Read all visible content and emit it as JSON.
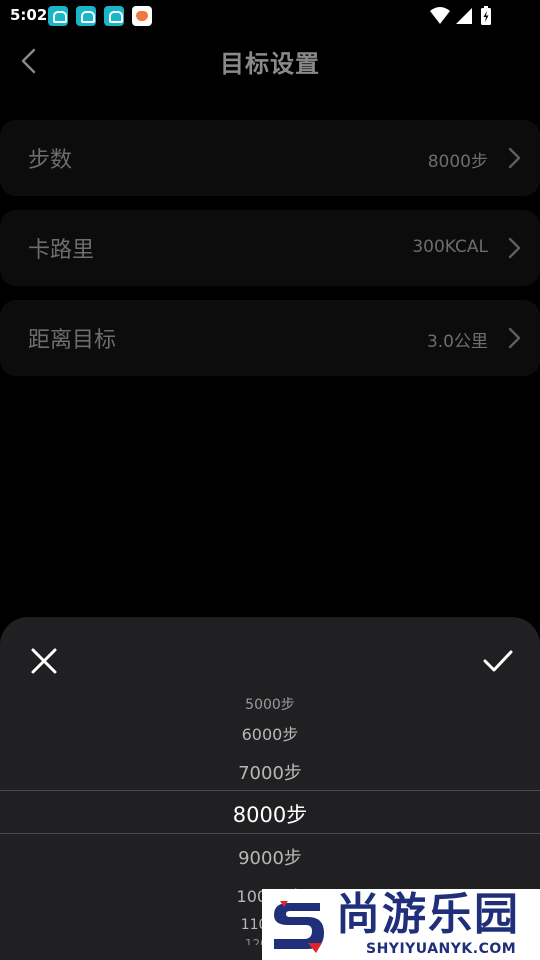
{
  "status_bar": {
    "time": "5:02",
    "icons": [
      "app-notification-icon",
      "app-notification-icon",
      "app-notification-icon",
      "health-app-icon",
      "wifi-icon",
      "signal-icon",
      "battery-charging-icon"
    ]
  },
  "header": {
    "back_icon": "chevron-left-icon",
    "title": "目标设置"
  },
  "settings": {
    "rows": [
      {
        "label": "步数",
        "value": "8000步"
      },
      {
        "label": "卡路里",
        "value": "300KCAL"
      },
      {
        "label": "距离目标",
        "value": "3.0公里"
      }
    ]
  },
  "sheet": {
    "close_icon": "close-icon",
    "confirm_icon": "check-icon",
    "picker": {
      "items": [
        "5000步",
        "6000步",
        "7000步",
        "8000步",
        "9000步",
        "10000步",
        "11000步",
        "12000步"
      ],
      "selected": "8000步"
    }
  },
  "watermark": {
    "text": "尚游乐园",
    "url": "SHYIYUANYK.COM"
  },
  "colors": {
    "background": "#000000",
    "row_background": "#0c0c0c",
    "sheet_background": "#202022",
    "muted_text": "#6d6d6d",
    "picker_text": "#b7b7b7",
    "brand_blue": "#1f2f7a",
    "brand_red": "#e0242b"
  }
}
